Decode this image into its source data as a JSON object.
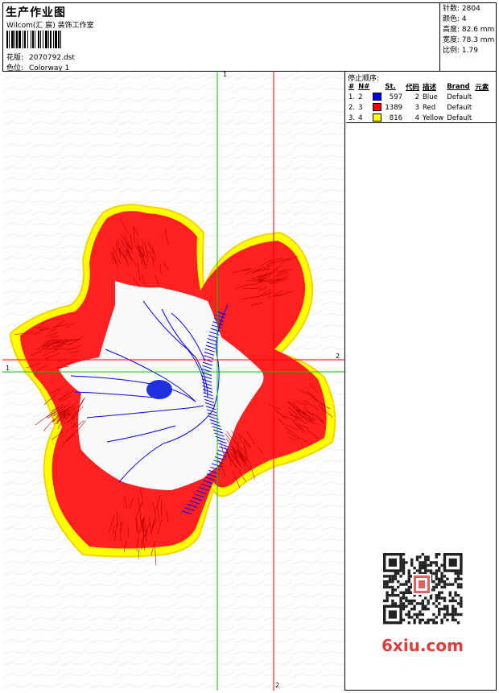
{
  "header": {
    "title": "生产作业图",
    "studio": "Wilcom(汇 宸) 装饰工作室",
    "pattern_label": "花版:",
    "pattern_value": "2070792.dst",
    "colorway_label": "色位:",
    "colorway_value": "Colorway 1"
  },
  "stats": {
    "stitches": "针数: 2804",
    "colors": "颜色: 4",
    "height": "高度: 82.6 mm",
    "width": "宽度: 78.3 mm",
    "ratio": "比例: 1.79"
  },
  "stop_sequence": {
    "title": "停止顺序:",
    "headers": [
      "#",
      "N#",
      "St.",
      "代码",
      "描述",
      "Brand",
      "元素"
    ],
    "rows": [
      {
        "num": "1.",
        "needle": "2",
        "color": "#0000ff",
        "stitches": "597",
        "code": "2",
        "desc": "Blue",
        "brand": "Default"
      },
      {
        "num": "2.",
        "needle": "3",
        "color": "#ff0000",
        "stitches": "1389",
        "code": "3",
        "desc": "Red",
        "brand": "Default"
      },
      {
        "num": "3.",
        "needle": "4",
        "color": "#ffff00",
        "stitches": "816",
        "code": "4",
        "desc": "Yellow",
        "brand": "Default"
      }
    ]
  },
  "guides": {
    "h1": "1",
    "h2": "2",
    "v1": "1",
    "v2": "2"
  },
  "watermark": "6xiu.com",
  "colors": {
    "guide_green": "#00cc00",
    "guide_red": "#ff0000",
    "thread_blue": "#0000ff",
    "thread_red": "#ff0000",
    "thread_yellow": "#ffff00"
  }
}
